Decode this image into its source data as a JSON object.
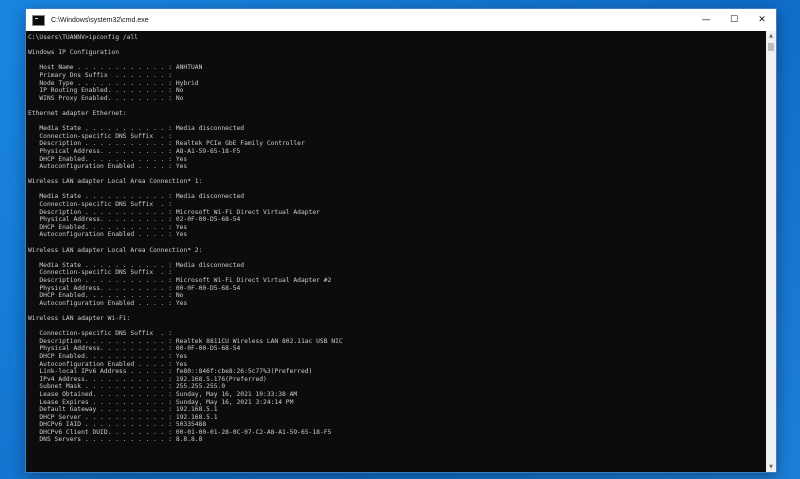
{
  "window": {
    "title": "C:\\Windows\\system32\\cmd.exe",
    "controls": {
      "minimize": "—",
      "maximize": "☐",
      "close": "✕"
    }
  },
  "console": {
    "lines": [
      "C:\\Users\\TUANNV>ipconfig /all",
      "",
      "Windows IP Configuration",
      "",
      "   Host Name . . . . . . . . . . . . : ANHTUAN",
      "   Primary Dns Suffix  . . . . . . . :",
      "   Node Type . . . . . . . . . . . . : Hybrid",
      "   IP Routing Enabled. . . . . . . . : No",
      "   WINS Proxy Enabled. . . . . . . . : No",
      "",
      "Ethernet adapter Ethernet:",
      "",
      "   Media State . . . . . . . . . . . : Media disconnected",
      "   Connection-specific DNS Suffix  . :",
      "   Description . . . . . . . . . . . : Realtek PCIe GbE Family Controller",
      "   Physical Address. . . . . . . . . : A8-A1-59-65-18-F5",
      "   DHCP Enabled. . . . . . . . . . . : Yes",
      "   Autoconfiguration Enabled . . . . : Yes",
      "",
      "Wireless LAN adapter Local Area Connection* 1:",
      "",
      "   Media State . . . . . . . . . . . : Media disconnected",
      "   Connection-specific DNS Suffix  . :",
      "   Description . . . . . . . . . . . : Microsoft Wi-Fi Direct Virtual Adapter",
      "   Physical Address. . . . . . . . . : 02-0F-00-D5-68-54",
      "   DHCP Enabled. . . . . . . . . . . : Yes",
      "   Autoconfiguration Enabled . . . . : Yes",
      "",
      "Wireless LAN adapter Local Area Connection* 2:",
      "",
      "   Media State . . . . . . . . . . . : Media disconnected",
      "   Connection-specific DNS Suffix  . :",
      "   Description . . . . . . . . . . . : Microsoft Wi-Fi Direct Virtual Adapter #2",
      "   Physical Address. . . . . . . . . : 00-0F-00-D5-68-54",
      "   DHCP Enabled. . . . . . . . . . . : No",
      "   Autoconfiguration Enabled . . . . : Yes",
      "",
      "Wireless LAN adapter Wi-Fi:",
      "",
      "   Connection-specific DNS Suffix  . :",
      "   Description . . . . . . . . . . . : Realtek 8811CU Wireless LAN 802.11ac USB NIC",
      "   Physical Address. . . . . . . . . : 00-0F-00-D5-68-54",
      "   DHCP Enabled. . . . . . . . . . . : Yes",
      "   Autoconfiguration Enabled . . . . : Yes",
      "   Link-local IPv6 Address . . . . . : fe80::846f:cbe8:26:5c77%3(Preferred)",
      "   IPv4 Address. . . . . . . . . . . : 192.168.5.176(Preferred)",
      "   Subnet Mask . . . . . . . . . . . : 255.255.255.0",
      "   Lease Obtained. . . . . . . . . . : Sunday, May 16, 2021 10:33:38 AM",
      "   Lease Expires . . . . . . . . . . : Sunday, May 16, 2021 3:24:14 PM",
      "   Default Gateway . . . . . . . . . : 192.168.5.1",
      "   DHCP Server . . . . . . . . . . . : 192.168.5.1",
      "   DHCPv6 IAID . . . . . . . . . . . : 50335488",
      "   DHCPv6 Client DUID. . . . . . . . : 00-01-00-01-28-0C-07-C2-A8-A1-59-65-18-F5",
      "   DNS Servers . . . . . . . . . . . : 8.8.8.8"
    ]
  },
  "scrollbar": {
    "up_arrow": "▲",
    "down_arrow": "▼"
  },
  "colors": {
    "desktop": "#1679d4",
    "console_bg": "#0c0c0c",
    "console_text": "#cccccc",
    "titlebar": "#ffffff"
  }
}
